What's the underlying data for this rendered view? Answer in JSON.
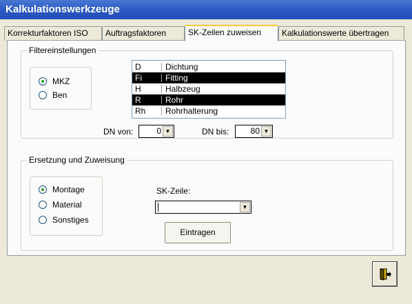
{
  "window": {
    "title": "Kalkulationswerkzeuge"
  },
  "tabs": [
    {
      "label": "Korrekturfaktoren ISO",
      "active": false
    },
    {
      "label": "Auftragsfaktoren",
      "active": false
    },
    {
      "label": "SK-Zeilen zuweisen",
      "active": true
    },
    {
      "label": "Kalkulationswerte übertragen",
      "active": false
    }
  ],
  "filter": {
    "legend": "Filtereinstellungen",
    "radios": [
      {
        "label": "MKZ",
        "checked": true
      },
      {
        "label": "Ben",
        "checked": false
      }
    ],
    "list": [
      {
        "code": "D",
        "name": "Dichtung",
        "selected": false
      },
      {
        "code": "Fi",
        "name": "Fitting",
        "selected": true
      },
      {
        "code": "H",
        "name": "Halbzeug",
        "selected": false
      },
      {
        "code": "R",
        "name": "Rohr",
        "selected": true
      },
      {
        "code": "Rh",
        "name": "Rohrhalterung",
        "selected": false
      }
    ],
    "dn_von_label": "DN von:",
    "dn_von_value": "0",
    "dn_bis_label": "DN bis:",
    "dn_bis_value": "80"
  },
  "assignment": {
    "legend": "Ersetzung und Zuweisung",
    "radios": [
      {
        "label": "Montage",
        "checked": true
      },
      {
        "label": "Material",
        "checked": false
      },
      {
        "label": "Sonstiges",
        "checked": false
      }
    ],
    "sk_label": "SK-Zeile:",
    "sk_value": "",
    "submit_label": "Eintragen"
  },
  "footer": {
    "exit_icon": "exit-door-icon"
  },
  "colors": {
    "title_bar": "#2a58c0",
    "selected_row": "#000000",
    "active_tab_accent": "#ffc73c"
  }
}
